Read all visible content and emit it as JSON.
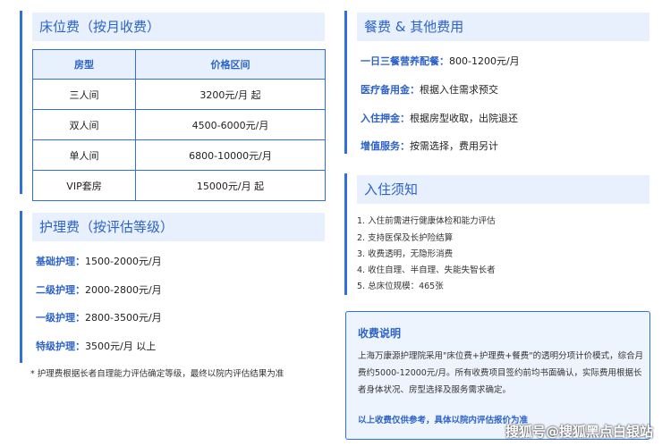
{
  "bed": {
    "title": "床位费（按月收费）",
    "headers": [
      "房型",
      "价格区间"
    ],
    "rows": [
      [
        "三人间",
        "3200元/月 起"
      ],
      [
        "双人间",
        "4500-6000元/月"
      ],
      [
        "单人间",
        "6800-10000元/月"
      ],
      [
        "VIP套房",
        "15000元/月 起"
      ]
    ]
  },
  "care": {
    "title": "护理费（按评估等级）",
    "items": [
      {
        "label": "基础护理：",
        "value": "1500-2000元/月"
      },
      {
        "label": "二级护理：",
        "value": "2000-2800元/月"
      },
      {
        "label": "一级护理：",
        "value": "2800-3500元/月"
      },
      {
        "label": "特级护理：",
        "value": "3500元/月 以上"
      }
    ],
    "note": "* 护理费根据长者自理能力评估确定等级，最终以院内评估结果为准"
  },
  "meal": {
    "title": "餐费 & 其他费用",
    "items": [
      {
        "label": "一日三餐营养配餐：",
        "value": "800-1200元/月"
      },
      {
        "label": "医疗备用金：",
        "value": "根据入住需求预交"
      },
      {
        "label": "入住押金：",
        "value": "根据房型收取，出院退还"
      },
      {
        "label": "增值服务：",
        "value": "按需选择，费用另计"
      }
    ]
  },
  "notice": {
    "title": "入住须知",
    "items": [
      "1. 入住前需进行健康体检和能力评估",
      "2. 支持医保及长护险结算",
      "3. 收费透明，无隐形消费",
      "4. 收住自理、半自理、失能失智长者",
      "5. 总床位规模：465张"
    ]
  },
  "explain": {
    "title": "收费说明",
    "text": "上海万康源护理院采用\"床位费+护理费+餐费\"的透明分项计价模式，综合月费约5000-12000元/月。所有收费项目签约前均书面确认，实际费用根据长者身体状况、房型选择及服务需求确定。",
    "footer": "以上收费仅供参考，具体以院内评估报价为准"
  },
  "watermark": "搜狐号@搜狐黑点白银站"
}
